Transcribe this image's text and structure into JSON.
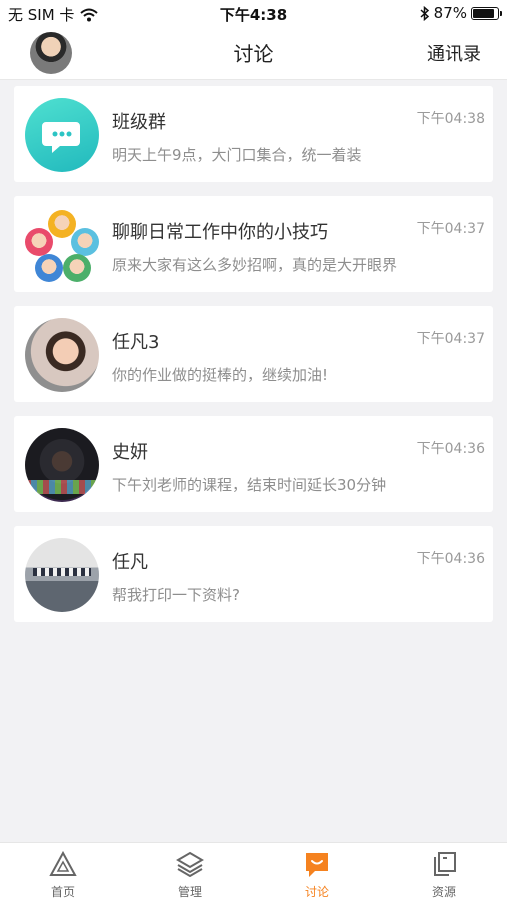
{
  "status_bar": {
    "carrier": "无 SIM 卡",
    "time": "下午4:38",
    "battery_percent": "87%",
    "battery_level": 0.87
  },
  "nav": {
    "title": "讨论",
    "right_action": "通讯录"
  },
  "conversations": [
    {
      "name": "班级群",
      "time": "下午04:38",
      "message": "明天上午9点，大门口集合，统一着装"
    },
    {
      "name": "聊聊日常工作中你的小技巧",
      "time": "下午04:37",
      "message": "原来大家有这么多妙招啊，真的是大开眼界"
    },
    {
      "name": "任凡3",
      "time": "下午04:37",
      "message": "你的作业做的挺棒的，继续加油!"
    },
    {
      "name": "史妍",
      "time": "下午04:36",
      "message": "下午刘老师的课程，结束时间延长30分钟"
    },
    {
      "name": "任凡",
      "time": "下午04:36",
      "message": "帮我打印一下资料?"
    }
  ],
  "tabs": [
    {
      "label": "首页",
      "icon": "home-triangle-icon",
      "active": false
    },
    {
      "label": "管理",
      "icon": "layers-icon",
      "active": false
    },
    {
      "label": "讨论",
      "icon": "chat-bubble-icon",
      "active": true
    },
    {
      "label": "资源",
      "icon": "files-icon",
      "active": false
    }
  ],
  "colors": {
    "accent": "#f5821f",
    "group_avatar": "#2cc4c4",
    "background": "#f2f2f4"
  }
}
